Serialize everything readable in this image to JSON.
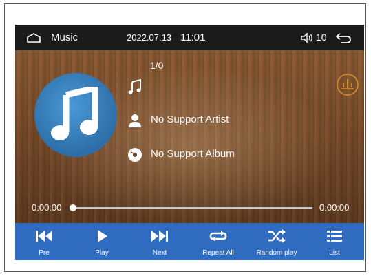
{
  "statusbar": {
    "title": "Music",
    "date": "2022.07.13",
    "time": "11:01",
    "volume": "10"
  },
  "track": {
    "index": "1/0",
    "artist": "No Support Artist",
    "album": "No Support Album"
  },
  "progress": {
    "current": "0:00:00",
    "total": "0:00:00",
    "fraction": 0
  },
  "controls": {
    "prev": "Pre",
    "play": "Play",
    "next": "Next",
    "repeat": "Repeat All",
    "random": "Random play",
    "list": "List"
  },
  "colors": {
    "statusbar_bg": "#1b1b1b",
    "controls_bg": "#2f6bbf",
    "album_art": "#3a86c8",
    "eq_accent": "#d08a2a"
  },
  "icons": [
    "home-icon",
    "volume-icon",
    "back-icon",
    "music-note-icon",
    "artist-icon",
    "album-icon",
    "equalizer-icon",
    "previous-icon",
    "play-icon",
    "next-icon",
    "repeat-icon",
    "shuffle-icon",
    "list-icon"
  ]
}
